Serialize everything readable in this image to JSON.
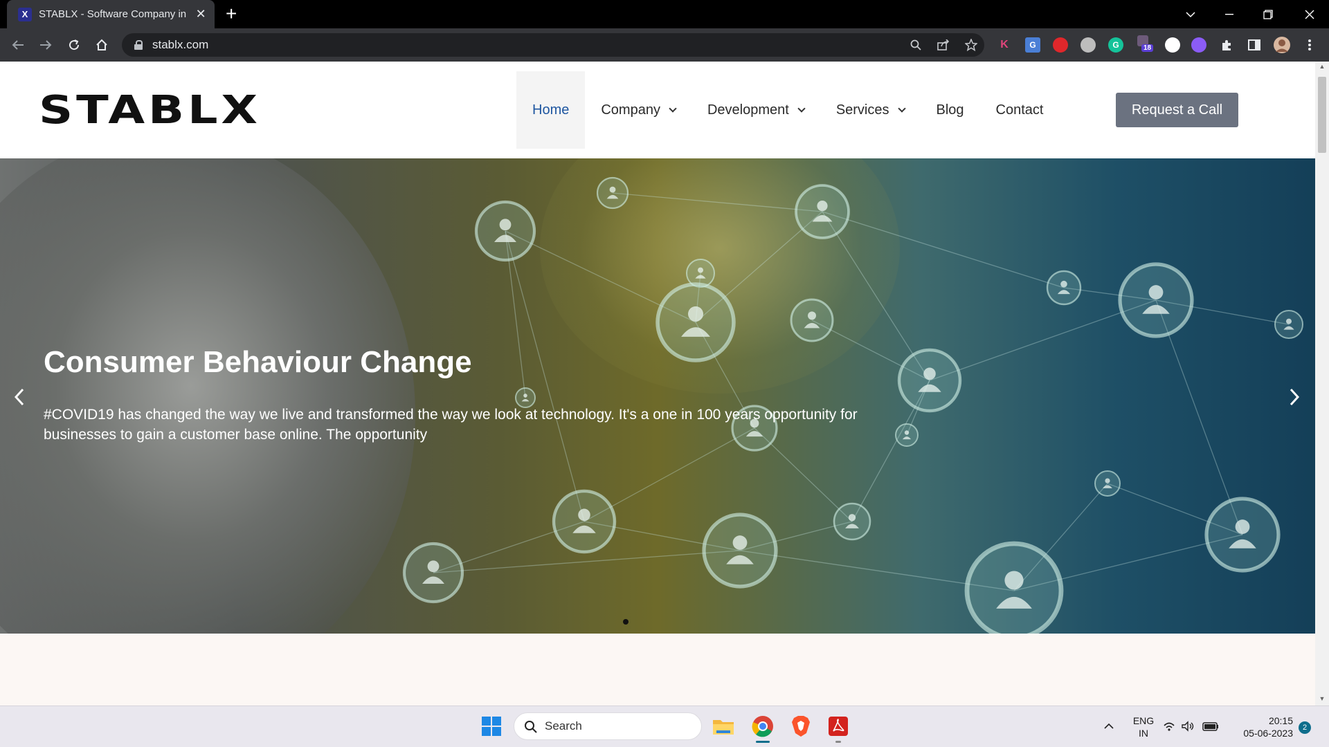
{
  "browser": {
    "tab_title": "STABLX - Software Company in India",
    "tab_favicon": "X",
    "tab_close": "✕",
    "new_tab": "+",
    "url": "stablx.com",
    "extensions": [
      {
        "name": "k-extension",
        "label": "K",
        "color": "#3b2f3f",
        "text_color": "#e0457b"
      },
      {
        "name": "translate-extension",
        "label": "G",
        "color": "#4a7fd6",
        "text_color": "#ffffff"
      },
      {
        "name": "red-extension",
        "label": "",
        "color": "#e0272b",
        "text_color": "#ffffff"
      },
      {
        "name": "globe-extension",
        "label": "",
        "color": "#bdbdbd",
        "text_color": "#ffffff"
      },
      {
        "name": "grammarly-extension",
        "label": "G",
        "color": "#15c39a",
        "text_color": "#ffffff"
      },
      {
        "name": "badge-extension",
        "label": "18",
        "color": "#5b3fd6",
        "text_color": "#ffffff"
      },
      {
        "name": "circle-extension",
        "label": "",
        "color": "#ffffff",
        "text_color": "#000000"
      },
      {
        "name": "color-extension",
        "label": "",
        "color": "#8b5cf6",
        "text_color": "#ffffff"
      }
    ]
  },
  "site": {
    "logo": "STABLX",
    "nav": [
      {
        "label": "Home",
        "active": true,
        "dropdown": false
      },
      {
        "label": "Company",
        "active": false,
        "dropdown": true
      },
      {
        "label": "Development",
        "active": false,
        "dropdown": true
      },
      {
        "label": "Services",
        "active": false,
        "dropdown": true
      },
      {
        "label": "Blog",
        "active": false,
        "dropdown": false
      },
      {
        "label": "Contact",
        "active": false,
        "dropdown": false
      }
    ],
    "cta": "Request a Call",
    "hero": {
      "title": "Consumer Behaviour Change",
      "text": "#COVID19 has changed the way we live and transformed the way we look at technology. It's a one in 100 years opportunity for businesses to gain a customer base online. The opportunity",
      "prev": "‹",
      "next": "›"
    }
  },
  "taskbar": {
    "search_placeholder": "Search",
    "lang_top": "ENG",
    "lang_bottom": "IN",
    "time": "20:15",
    "date": "05-06-2023",
    "notifications": "2"
  }
}
